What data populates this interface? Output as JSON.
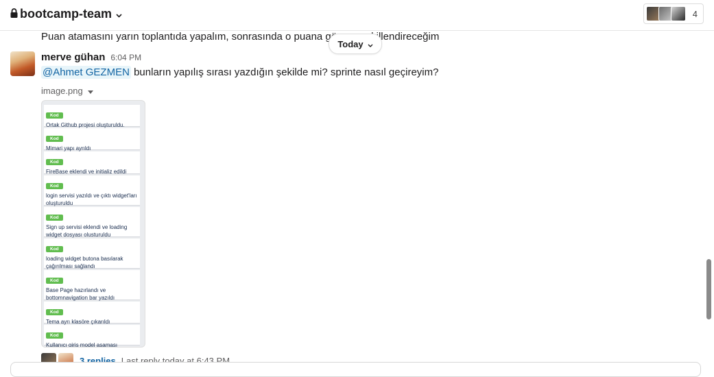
{
  "header": {
    "channel_name": "bootcamp-team",
    "member_count": "4"
  },
  "previous_message": {
    "text": "Puan atamasını yarın toplantıda yapalım, sonrasında o puana göre ... şekillendireceğim"
  },
  "date_divider": {
    "label": "Today"
  },
  "message": {
    "sender": "merve gühan",
    "time": "6:04 PM",
    "mention": "@Ahmet GEZMEN",
    "text": " bunların yapılış sırası yazdığın şekilde mi? sprinte nasıl geçireyim?",
    "file_name": "image.png"
  },
  "image_cards": [
    {
      "label": "Kod",
      "text": "Ortak Github projesi oluşturuldu."
    },
    {
      "label": "Kod",
      "text": "Mimari yapı ayrıldı"
    },
    {
      "label": "Kod",
      "text": "FireBase eklendi ve initializ edildi"
    },
    {
      "label": "Kod",
      "text": "login servisi yazıldı ve çıktı widget'ları oluşturuldu"
    },
    {
      "label": "Kod",
      "text": "Sign up servisi eklendi ve loading widget dosyası olusturuldu"
    },
    {
      "label": "Kod",
      "text": "loading widget butona basılarak çağırılması sağlandı"
    },
    {
      "label": "Kod",
      "text": "Base Page hazırlandı ve bottomnavigation bar yazıldı"
    },
    {
      "label": "Kod",
      "text": "Tema ayrı klasöre çıkarıldı"
    },
    {
      "label": "Kod",
      "text": "Kullanıcı giriş model aşaması"
    }
  ],
  "thread": {
    "replies": "3 replies",
    "last_reply": "Last reply today at 6:43 PM"
  },
  "colors": {
    "accent_link": "#1264a3",
    "label_green": "#61bd4f"
  }
}
